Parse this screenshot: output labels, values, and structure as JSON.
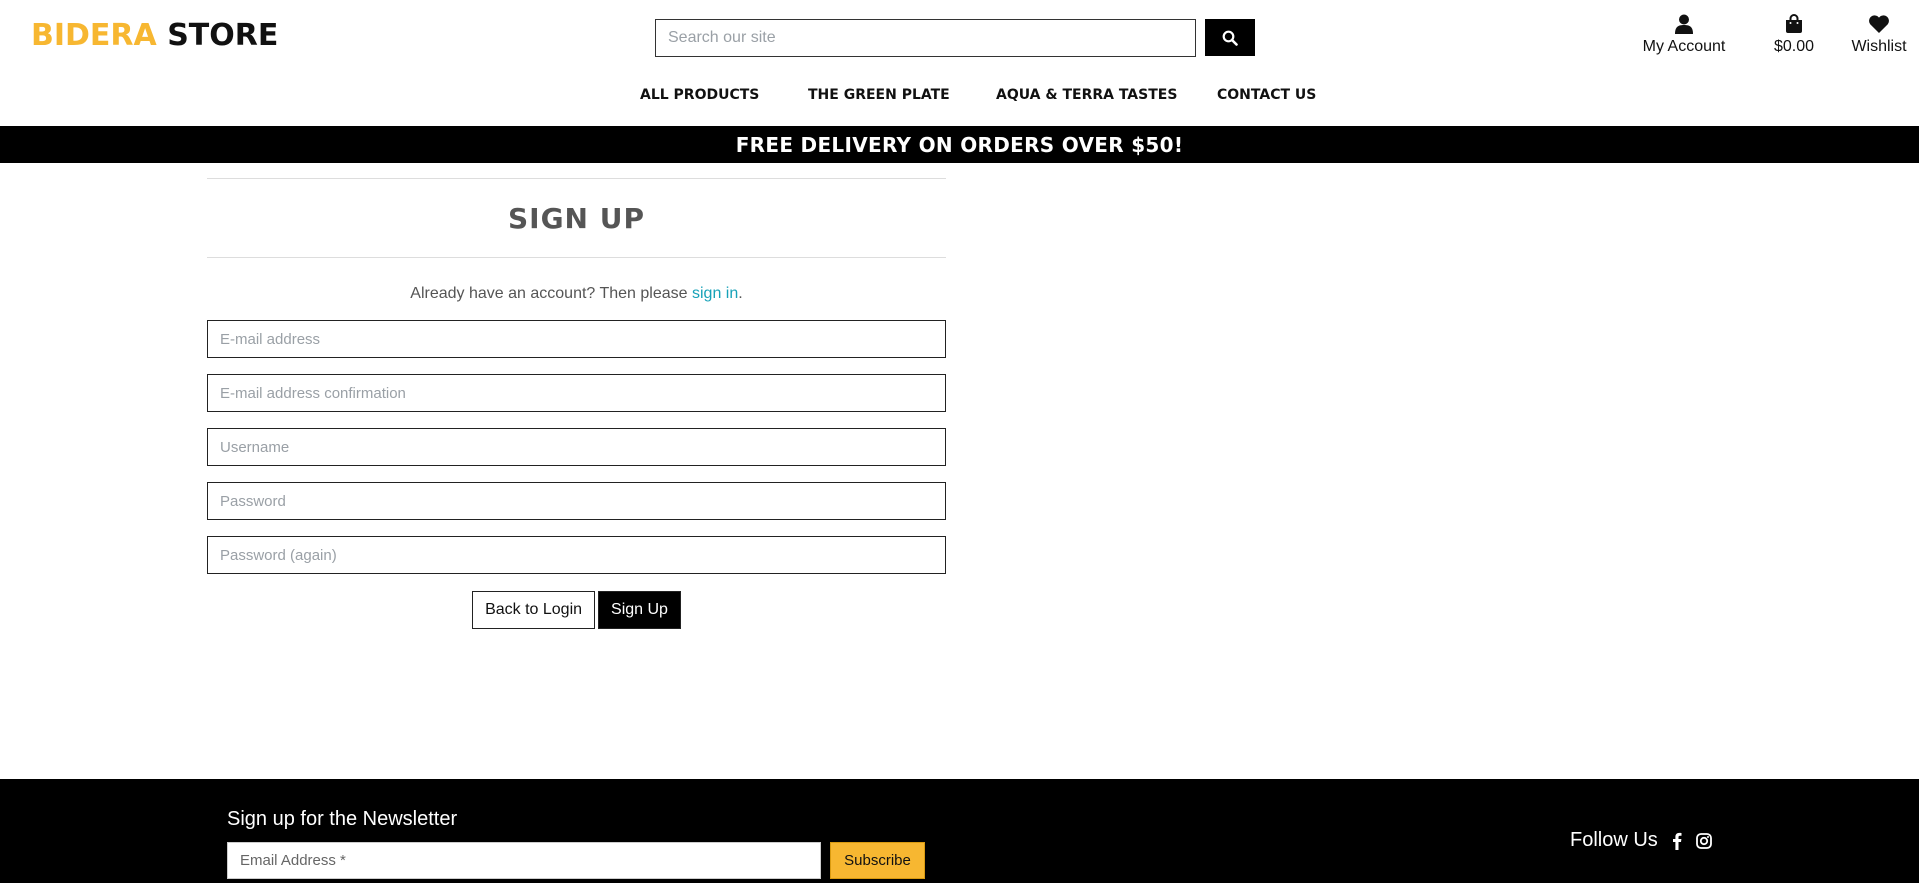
{
  "header": {
    "logo_brand": "BIDERA",
    "logo_store": "STORE",
    "search_placeholder": "Search our site",
    "account_label": "My Account",
    "bag_total": "$0.00",
    "wishlist_label": "Wishlist"
  },
  "nav": {
    "items": [
      {
        "label": "All Products"
      },
      {
        "label": "The Green Plate"
      },
      {
        "label": "Aqua & Terra Tastes"
      },
      {
        "label": "Contact Us"
      }
    ]
  },
  "banner": {
    "text": "FREE DELIVERY ON ORDERS OVER $50!"
  },
  "signup": {
    "title": "Sign Up",
    "already_text": "Already have an account? Then please ",
    "signin_link": "sign in",
    "period": ".",
    "fields": {
      "email": "E-mail address",
      "email_confirm": "E-mail address confirmation",
      "username": "Username",
      "password": "Password",
      "password_again": "Password (again)"
    },
    "back_label": "Back to Login",
    "submit_label": "Sign Up"
  },
  "footer": {
    "newsletter_title": "Sign up for the Newsletter",
    "newsletter_placeholder": "Email Address *",
    "subscribe_label": "Subscribe",
    "follow_label": "Follow Us",
    "social_icons": [
      "facebook-icon",
      "instagram-icon"
    ]
  },
  "colors": {
    "accent": "#f7b731",
    "link": "#17a2b8",
    "dark": "#000000"
  }
}
